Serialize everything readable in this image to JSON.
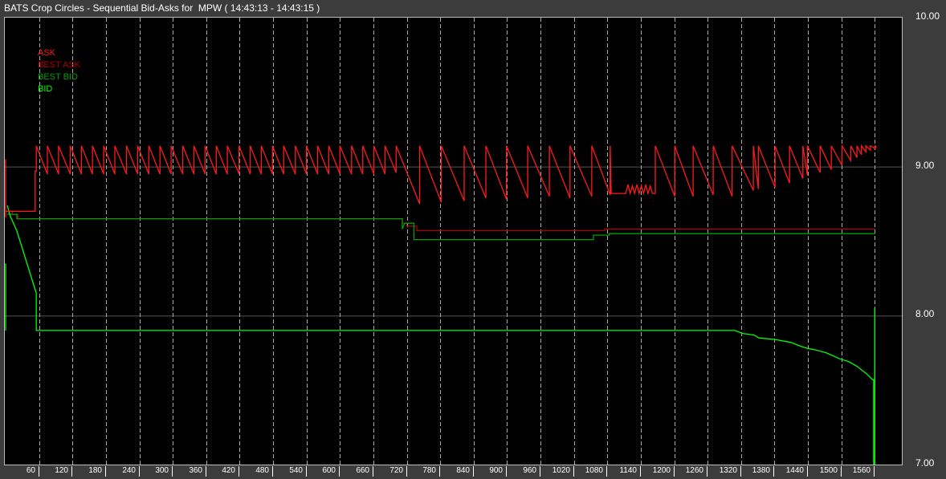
{
  "window": {
    "title": "BATS Crop Circles - Sequential Bid-Asks for  MPW ( 14:43:13 - 14:43:15 )"
  },
  "chart_data": {
    "type": "line",
    "title": "BATS Crop Circles - Sequential Bid-Asks for  MPW ( 14:43:13 - 14:43:15 )",
    "xlabel": "",
    "ylabel": "",
    "xlim": [
      0,
      1610
    ],
    "ylim": [
      7,
      10
    ],
    "x_ticks": [
      60,
      120,
      180,
      240,
      300,
      360,
      420,
      480,
      540,
      600,
      660,
      720,
      780,
      840,
      900,
      960,
      1020,
      1080,
      1140,
      1200,
      1260,
      1320,
      1380,
      1440,
      1500,
      1560
    ],
    "y_ticks": [
      "7.00",
      "8.00",
      "9.00",
      "10.00"
    ],
    "y_tick_values": [
      7,
      8,
      9,
      10
    ],
    "grid": true,
    "legend_position": "top-left",
    "legend": [
      "ASK",
      "BEST ASK",
      "BEST BID",
      "BID"
    ],
    "colors": {
      "ASK": "#ff1a1a",
      "BEST ASK": "#b00000",
      "BEST BID": "#00a000",
      "BID": "#00ff00",
      "grid_h": "#555555",
      "grid_v": "#aaaaaa"
    },
    "series": {
      "ask_initial": [
        [
          0,
          8.66
        ],
        [
          0,
          9.05
        ],
        [
          0,
          8.7
        ],
        [
          53,
          8.7
        ],
        [
          53,
          8.97
        ],
        [
          55,
          8.97
        ]
      ],
      "ask_peak": 9.14,
      "ask_teeth": [
        [
          55,
          8.95
        ],
        [
          75,
          8.95
        ],
        [
          95,
          8.95
        ],
        [
          116,
          8.95
        ],
        [
          136,
          8.95
        ],
        [
          156,
          8.95
        ],
        [
          176,
          8.95
        ],
        [
          196,
          8.95
        ],
        [
          217,
          8.95
        ],
        [
          237,
          8.95
        ],
        [
          257,
          8.95
        ],
        [
          277,
          8.95
        ],
        [
          297,
          8.95
        ],
        [
          318,
          8.95
        ],
        [
          338,
          8.95
        ],
        [
          358,
          8.95
        ],
        [
          378,
          8.95
        ],
        [
          398,
          8.95
        ],
        [
          419,
          8.95
        ],
        [
          439,
          8.95
        ],
        [
          459,
          8.95
        ],
        [
          479,
          8.95
        ],
        [
          499,
          8.95
        ],
        [
          520,
          8.95
        ],
        [
          540,
          8.95
        ],
        [
          560,
          8.95
        ],
        [
          580,
          8.95
        ],
        [
          600,
          8.95
        ],
        [
          621,
          8.95
        ],
        [
          641,
          8.95
        ],
        [
          661,
          8.95
        ],
        [
          681,
          8.96
        ],
        [
          701,
          8.75
        ],
        [
          743,
          8.76
        ],
        [
          782,
          8.77
        ],
        [
          823,
          8.79
        ],
        [
          862,
          8.78
        ],
        [
          899,
          8.79
        ],
        [
          937,
          8.8
        ],
        [
          976,
          8.79
        ],
        [
          1013,
          8.8
        ],
        [
          1052,
          8.81
        ],
        [
          1085,
          8.82
        ]
      ],
      "ask_chop": [
        [
          1113,
          8.82
        ],
        [
          1117,
          8.88
        ],
        [
          1121,
          8.82
        ],
        [
          1125,
          8.87
        ],
        [
          1129,
          8.82
        ],
        [
          1133,
          8.88
        ],
        [
          1137,
          8.82
        ],
        [
          1141,
          8.87
        ],
        [
          1145,
          8.82
        ],
        [
          1149,
          8.88
        ],
        [
          1153,
          8.82
        ],
        [
          1157,
          8.87
        ],
        [
          1161,
          8.82
        ],
        [
          1165,
          8.82
        ]
      ],
      "ask_teeth2": [
        [
          1166,
          8.8
        ],
        [
          1201,
          8.8
        ],
        [
          1234,
          8.81
        ],
        [
          1270,
          8.8
        ],
        [
          1304,
          8.84
        ],
        [
          1342,
          8.85
        ],
        [
          1351,
          8.86
        ],
        [
          1381,
          8.89
        ],
        [
          1407,
          8.92
        ],
        [
          1431,
          8.94
        ],
        [
          1439,
          8.96
        ],
        [
          1462,
          8.98
        ],
        [
          1482,
          9.01
        ],
        [
          1501,
          9.04
        ],
        [
          1517,
          9.06
        ],
        [
          1528,
          9.08
        ],
        [
          1536,
          9.1
        ],
        [
          1544,
          9.11
        ],
        [
          1552,
          9.12
        ],
        [
          1561,
          9.13
        ]
      ],
      "best_ask": [
        [
          3,
          8.7
        ],
        [
          12,
          8.7
        ],
        [
          12,
          8.68
        ],
        [
          22,
          8.68
        ],
        [
          22,
          8.65
        ],
        [
          712,
          8.65
        ],
        [
          712,
          8.62
        ],
        [
          720,
          8.62
        ],
        [
          720,
          8.6
        ],
        [
          738,
          8.6
        ],
        [
          738,
          8.57
        ],
        [
          1075,
          8.57
        ],
        [
          1075,
          8.58
        ],
        [
          1561,
          8.58
        ]
      ],
      "best_bid": [
        [
          3,
          8.68
        ],
        [
          20,
          8.68
        ],
        [
          20,
          8.65
        ],
        [
          712,
          8.65
        ],
        [
          712,
          8.58
        ],
        [
          716,
          8.62
        ],
        [
          733,
          8.62
        ],
        [
          733,
          8.51
        ],
        [
          1055,
          8.51
        ],
        [
          1055,
          8.54
        ],
        [
          1083,
          8.54
        ],
        [
          1083,
          8.55
        ],
        [
          1561,
          8.55
        ]
      ],
      "bid": [
        [
          3,
          8.74
        ],
        [
          8,
          8.67
        ],
        [
          20,
          8.57
        ],
        [
          55,
          8.15
        ],
        [
          55,
          7.9
        ],
        [
          1309,
          7.9
        ],
        [
          1323,
          7.88
        ],
        [
          1343,
          7.87
        ],
        [
          1352,
          7.85
        ],
        [
          1380,
          7.84
        ],
        [
          1410,
          7.82
        ],
        [
          1423,
          7.8
        ],
        [
          1439,
          7.78
        ],
        [
          1453,
          7.77
        ],
        [
          1473,
          7.75
        ],
        [
          1497,
          7.71
        ],
        [
          1514,
          7.69
        ],
        [
          1528,
          7.66
        ],
        [
          1545,
          7.61
        ],
        [
          1556,
          7.57
        ],
        [
          1558,
          7.57
        ],
        [
          1558,
          7.0
        ],
        [
          1560,
          7.0
        ],
        [
          1560,
          8.05
        ]
      ],
      "bid_initial": [
        [
          0,
          7.9
        ],
        [
          0,
          8.35
        ]
      ]
    }
  }
}
